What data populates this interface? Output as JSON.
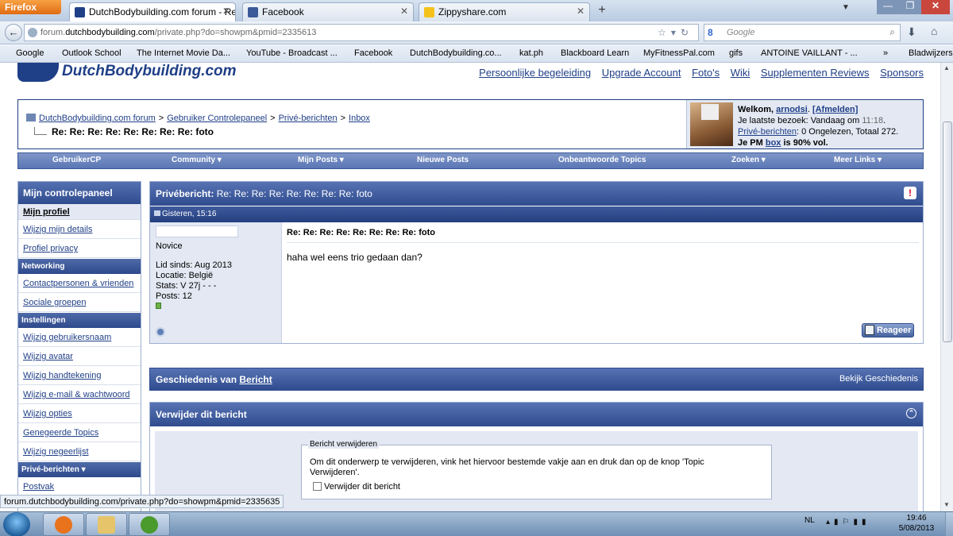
{
  "browser": {
    "menu_button": "Firefox",
    "tabs": [
      {
        "title": "DutchBodybuilding.com forum - Re: ...",
        "active": true,
        "color": "#1f3f87"
      },
      {
        "title": "Facebook",
        "active": false,
        "color": "#3b5998"
      },
      {
        "title": "Zippyshare.com",
        "active": false,
        "color": "#f4c21b"
      }
    ],
    "new_tab": "+",
    "url": {
      "prefix": "forum.",
      "host": "dutchbodybuilding.com",
      "path": "/private.php?do=showpm&pmid=2335613"
    },
    "search_placeholder": "Google",
    "window_controls": {
      "minimize": "—",
      "maximize": "❐",
      "close": "✕"
    }
  },
  "bookmarks": [
    {
      "label": "Google",
      "icon": "google-icon",
      "color": "#4285f4"
    },
    {
      "label": "Outlook School",
      "icon": "outlook-icon",
      "color": "#dfe6ef"
    },
    {
      "label": "The Internet Movie Da...",
      "icon": "imdb-icon",
      "color": "#e6b91e"
    },
    {
      "label": "YouTube - Broadcast ...",
      "icon": "youtube-icon",
      "color": "#cc181e"
    },
    {
      "label": "Facebook",
      "icon": "facebook-icon",
      "color": "#3b5998"
    },
    {
      "label": "DutchBodybuilding.co...",
      "icon": "dbb-icon",
      "color": "#1f3f87"
    },
    {
      "label": "kat.ph",
      "icon": "kat-icon",
      "color": "#555555"
    },
    {
      "label": "Blackboard Learn",
      "icon": "blackboard-icon",
      "color": "#333333"
    },
    {
      "label": "MyFitnessPal.com",
      "icon": "myfitnesspal-icon",
      "color": "#1a73c8"
    },
    {
      "label": "gifs",
      "icon": "folder-icon",
      "color": "#e8c55a"
    },
    {
      "label": "ANTOINE VAILLANT - ...",
      "icon": "antoine-icon",
      "color": "#c0392b"
    },
    {
      "label": "Bladwijzers",
      "icon": "bookmarks-icon",
      "color": "#5a6f8f"
    }
  ],
  "more_bookmarks": "»",
  "site": {
    "logo_text": "DutchBodybuilding.com",
    "top_links": [
      "Persoonlijke begeleiding",
      "Upgrade Account",
      "Foto's",
      "Wiki",
      "Supplementen Reviews",
      "Sponsors"
    ],
    "breadcrumbs": [
      "DutchBodybuilding.com forum",
      "Gebruiker Controlepaneel",
      "Privé-berichten",
      "Inbox"
    ],
    "breadcrumb_sep": ">",
    "thread_title": "Re: Re: Re: Re: Re: Re: Re: Re: foto",
    "welcome": {
      "welcome_label": "Welkom,",
      "username": "arnodsi",
      "logout": "[Afmelden]",
      "last_visit_label": "Je laatste bezoek: Vandaag om",
      "last_visit_time": "11:18",
      "pm_link": "Privé-berichten",
      "pm_stats": ": 0 Ongelezen, Totaal 272.",
      "box_prefix": "Je PM",
      "box_link": "box",
      "box_suffix": "is 90% vol."
    },
    "menu": [
      "GebruikerCP",
      "Community ▾",
      "Mijn Posts ▾",
      "Nieuwe Posts",
      "Onbeantwoorde Topics",
      "Zoeken ▾",
      "Meer Links ▾"
    ]
  },
  "sidebar": {
    "title": "Mijn controlepaneel",
    "groups": [
      {
        "section": null,
        "links": [
          "Mijn profiel",
          "Wijzig mijn details",
          "Profiel privacy"
        ]
      },
      {
        "section": "Networking",
        "links": [
          "Contactpersonen & vrienden",
          "Sociale groepen"
        ]
      },
      {
        "section": "Instellingen",
        "links": [
          "Wijzig gebruikersnaam",
          "Wijzig avatar",
          "Wijzig handtekening",
          "Wijzig e-mail & wachtwoord",
          "Wijzig opties",
          "Genegeerde Topics",
          "Wijzig negeerlijst"
        ]
      },
      {
        "section": "Privé-berichten ▾",
        "links": [
          "Postvak"
        ]
      }
    ]
  },
  "post": {
    "header_label": "Privébericht:",
    "header_title": "Re: Re: Re: Re: Re: Re: Re: Re: foto",
    "date": "Gisteren, 15:16",
    "user_title": "Novice",
    "join_date": "Lid sinds: Aug 2013",
    "location": "Locatie: België",
    "stats": "Stats: V 27j - - -",
    "posts": "Posts: 12",
    "message_title": "Re: Re: Re: Re: Re: Re: Re: Re: foto",
    "message_body": "haha wel eens trio gedaan dan?",
    "reply_button": "Reageer"
  },
  "history": {
    "label": "Geschiedenis van",
    "link": "Bericht",
    "view_link": "Bekijk Geschiedenis"
  },
  "delete_panel": {
    "title": "Verwijder dit bericht",
    "legend": "Bericht verwijderen",
    "description": "Om dit onderwerp te verwijderen, vink het hiervoor bestemde vakje aan en druk dan op de knop 'Topic Verwijderen'.",
    "checkbox_label": "Verwijder dit bericht"
  },
  "statusbar": "forum.dutchbodybuilding.com/private.php?do=showpm&pmid=2335635",
  "taskbar": {
    "apps": [
      {
        "name": "firefox",
        "color": "#e8731c"
      },
      {
        "name": "explorer",
        "color": "#e5c46a"
      },
      {
        "name": "utorrent",
        "color": "#4a9a2c"
      }
    ],
    "language": "NL",
    "time": "19:46",
    "date": "5/08/2013"
  }
}
